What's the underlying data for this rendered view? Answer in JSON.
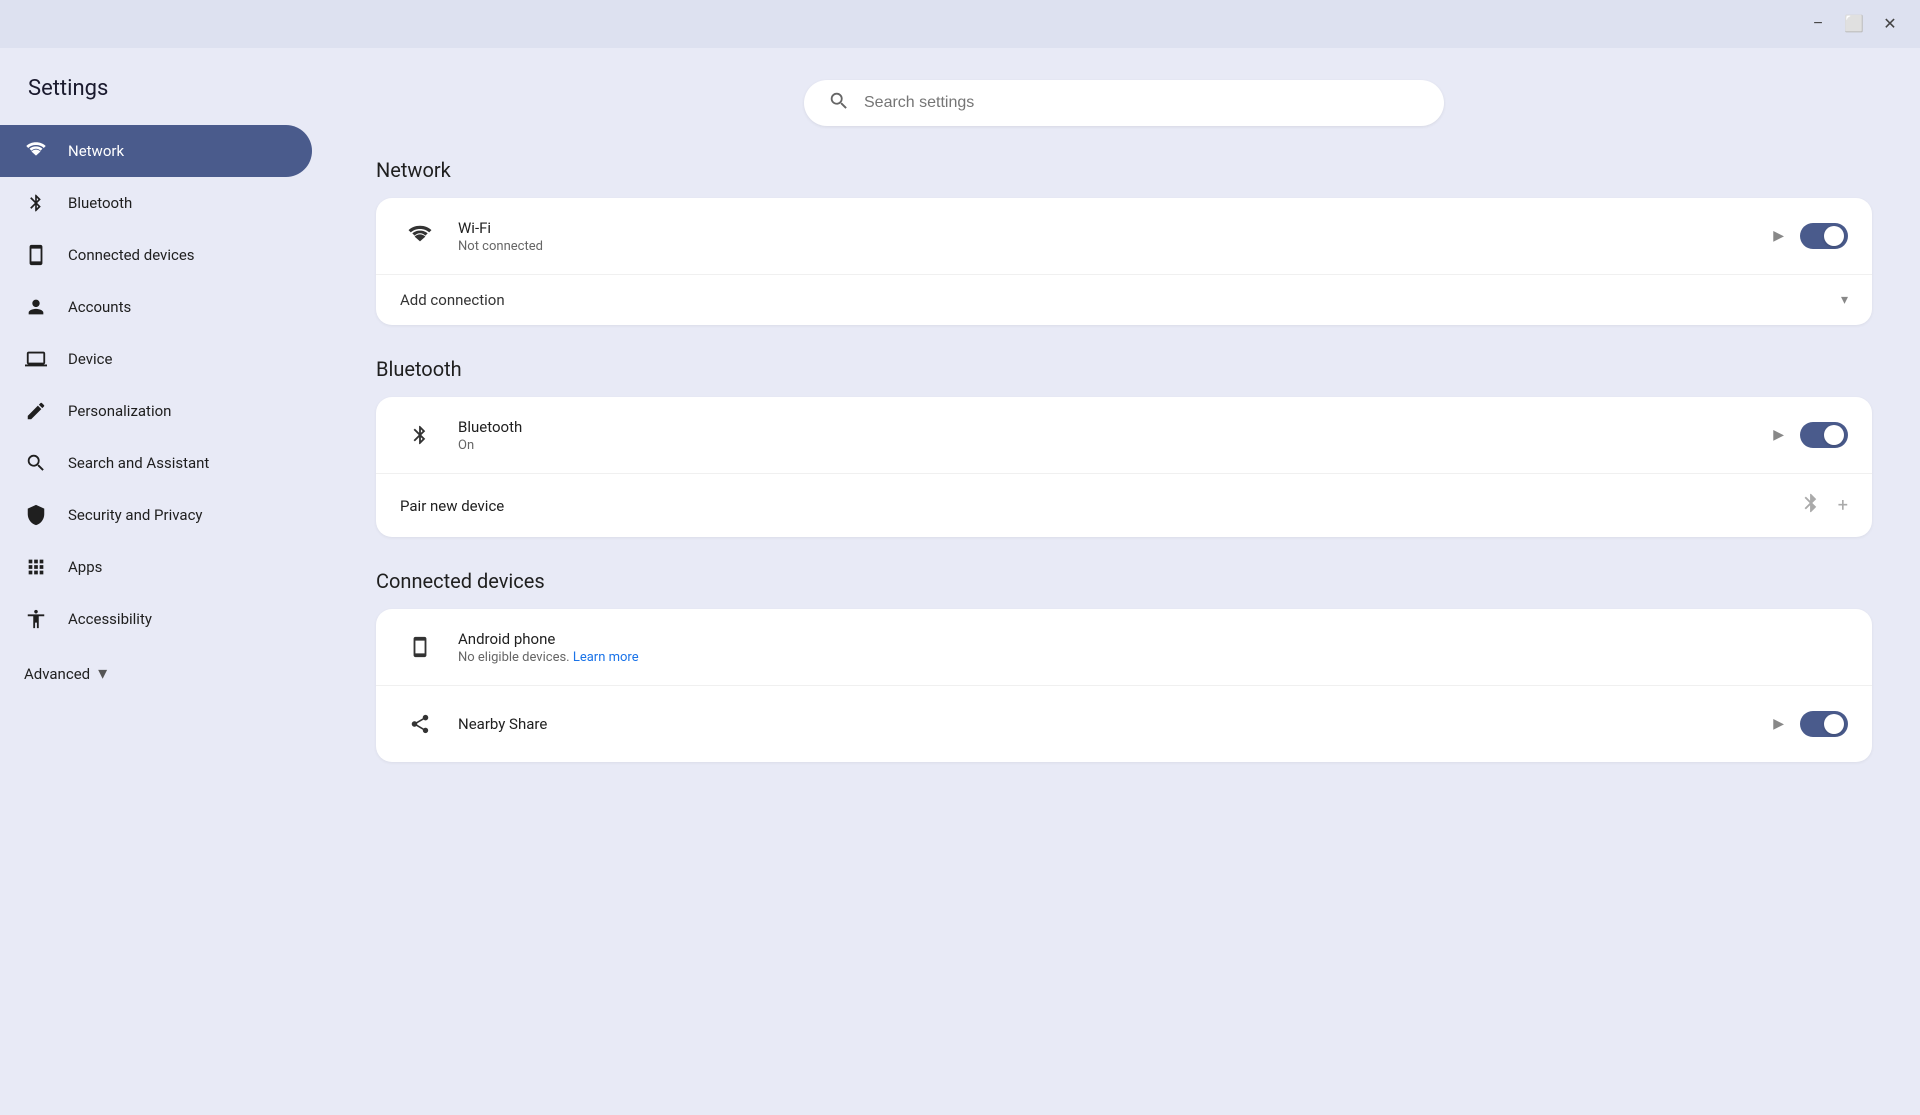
{
  "titlebar": {
    "minimize_label": "−",
    "maximize_label": "⬜",
    "close_label": "✕"
  },
  "sidebar": {
    "title": "Settings",
    "items": [
      {
        "id": "network",
        "label": "Network",
        "icon": "wifi",
        "active": true
      },
      {
        "id": "bluetooth",
        "label": "Bluetooth",
        "icon": "bluetooth"
      },
      {
        "id": "connected-devices",
        "label": "Connected devices",
        "icon": "device"
      },
      {
        "id": "accounts",
        "label": "Accounts",
        "icon": "person"
      },
      {
        "id": "device",
        "label": "Device",
        "icon": "laptop"
      },
      {
        "id": "personalization",
        "label": "Personalization",
        "icon": "edit"
      },
      {
        "id": "search-assistant",
        "label": "Search and Assistant",
        "icon": "search"
      },
      {
        "id": "security-privacy",
        "label": "Security and Privacy",
        "icon": "shield"
      },
      {
        "id": "apps",
        "label": "Apps",
        "icon": "apps"
      },
      {
        "id": "accessibility",
        "label": "Accessibility",
        "icon": "accessibility"
      }
    ],
    "advanced_label": "Advanced"
  },
  "search": {
    "placeholder": "Search settings"
  },
  "main": {
    "network_section": {
      "title": "Network",
      "card": {
        "wifi_title": "Wi-Fi",
        "wifi_status": "Not connected",
        "wifi_enabled": true,
        "add_connection_label": "Add connection"
      }
    },
    "bluetooth_section": {
      "title": "Bluetooth",
      "card": {
        "bt_title": "Bluetooth",
        "bt_status": "On",
        "bt_enabled": true,
        "pair_label": "Pair new device"
      }
    },
    "connected_devices_section": {
      "title": "Connected devices",
      "card": {
        "android_title": "Android phone",
        "android_sub": "No eligible devices.",
        "android_link": "Learn more",
        "nearby_title": "Nearby Share",
        "nearby_enabled": true
      }
    }
  }
}
